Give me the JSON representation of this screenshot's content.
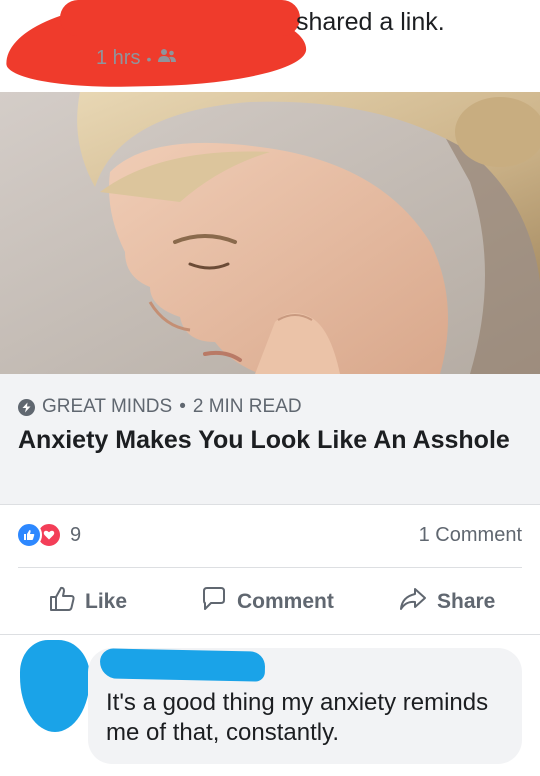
{
  "post": {
    "action_text": "shared a link.",
    "timestamp": "1 hrs",
    "separator": "•",
    "audience_icon": "friends-icon"
  },
  "link": {
    "source": "GREAT MINDS",
    "separator": "•",
    "read_time": "2 MIN READ",
    "title": "Anxiety Makes You Look Like An Asshole"
  },
  "reactions": {
    "icons": [
      "like-reaction-icon",
      "love-reaction-icon"
    ],
    "count": "9",
    "comments_count": "1 Comment"
  },
  "actions": {
    "like": "Like",
    "comment": "Comment",
    "share": "Share"
  },
  "comment": {
    "text": "It's a good thing my anxiety reminds me of that, constantly."
  },
  "colors": {
    "redaction_red": "#ef3b2c",
    "redaction_blue": "#1aa3e8",
    "like_blue": "#2d88ff",
    "love_red": "#f33e58",
    "muted_text": "#606770"
  }
}
